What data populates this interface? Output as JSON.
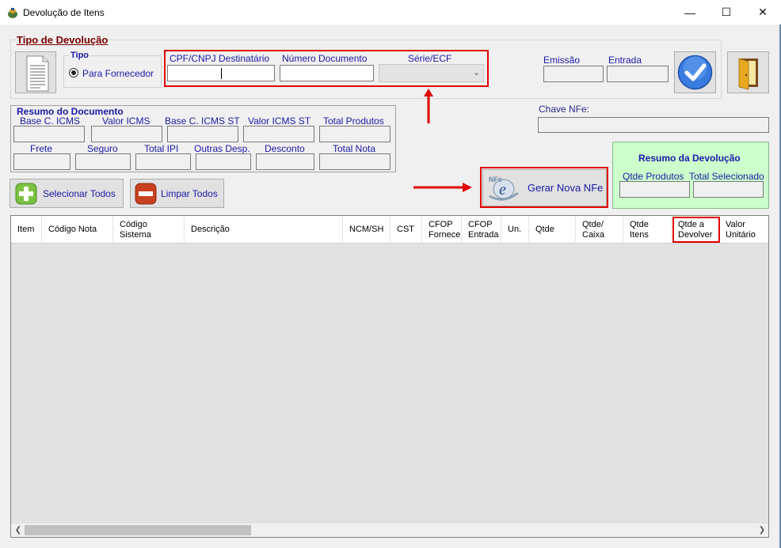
{
  "window": {
    "title": "Devolução de Itens",
    "minimize": "—",
    "maximize": "☐",
    "close": "✕"
  },
  "tipo_devolucao": {
    "title": "Tipo de Devolução",
    "tipo_label": "Tipo",
    "radio_label": "Para Fornecedor",
    "radio_selected": true,
    "cpf_label": "CPF/CNPJ Destinatário",
    "cpf_value": "",
    "numero_label": "Número Documento",
    "numero_value": "",
    "serie_label": "Série/ECF",
    "serie_value": "",
    "emissao_label": "Emissão",
    "entrada_label": "Entrada"
  },
  "chave": {
    "label": "Chave NFe:",
    "value": ""
  },
  "resumo_documento": {
    "title": "Resumo do Documento",
    "row1": [
      "Base C. ICMS",
      "Valor ICMS",
      "Base C. ICMS ST",
      "Valor ICMS ST",
      "Total Produtos"
    ],
    "row2": [
      "Frete",
      "Seguro",
      "Total IPI",
      "Outras Desp.",
      "Desconto",
      "Total Nota"
    ]
  },
  "resumo_devolucao": {
    "title": "Resumo da Devolução",
    "qtde_label": "Qtde Produtos",
    "total_label": "Total Selecionado"
  },
  "buttons": {
    "selecionar": "Selecionar Todos",
    "limpar": "Limpar Todos",
    "gerar": "Gerar Nova NFe"
  },
  "table": {
    "columns": [
      "Item",
      "Código Nota",
      "Código\nSistema",
      "Descrição",
      "NCM/SH",
      "CST",
      "CFOP\nFornece",
      "CFOP\nEntrada",
      "Un.",
      "Qtde",
      "Qtde/\nCaixa",
      "Qtde\nItens",
      "Qtde a\nDevolver",
      "Valor\nUnitário"
    ],
    "rows": []
  },
  "colors": {
    "label_blue": "#1a1aa6",
    "title_red": "#7b0000",
    "highlight_red": "#e00000",
    "devolucao_green": "#ccffcc"
  }
}
